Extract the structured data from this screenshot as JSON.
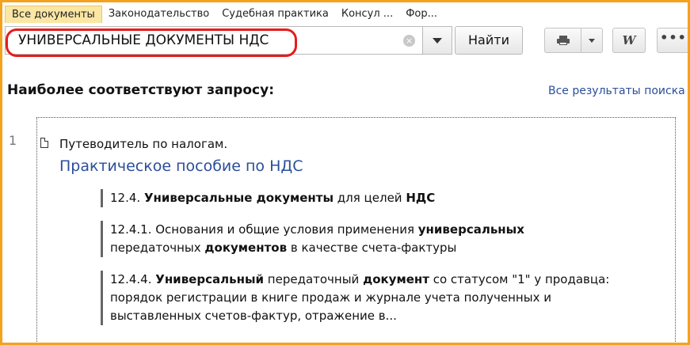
{
  "tabs": [
    {
      "label": "Все документы",
      "active": true
    },
    {
      "label": "Законодательство"
    },
    {
      "label": "Судебная практика"
    },
    {
      "label": "Консул ..."
    },
    {
      "label": "Фор..."
    }
  ],
  "search": {
    "value": "УНИВЕРСАЛЬНЫЕ ДОКУМЕНТЫ НДС",
    "clear_glyph": "×",
    "find_label": "Найти"
  },
  "toolbar": {
    "word_label": "W",
    "more_label": "•••"
  },
  "results": {
    "heading": "Наиболее соответствуют запросу:",
    "all_results_label": "Все результаты поиска",
    "items": [
      {
        "number": "1",
        "source": "Путеводитель по налогам.",
        "title": "Практическое пособие по НДС",
        "sections": [
          {
            "parts": [
              {
                "t": "12.4. ",
                "b": false
              },
              {
                "t": "Универсальные документы",
                "b": true
              },
              {
                "t": " для целей ",
                "b": false
              },
              {
                "t": "НДС",
                "b": true
              }
            ]
          },
          {
            "parts": [
              {
                "t": "12.4.1. Основания и общие условия применения ",
                "b": false
              },
              {
                "t": "универсальных",
                "b": true
              },
              {
                "t": " передаточных ",
                "b": false
              },
              {
                "t": "документов",
                "b": true
              },
              {
                "t": " в качестве счета-фактуры",
                "b": false
              }
            ]
          },
          {
            "parts": [
              {
                "t": "12.4.4. ",
                "b": false
              },
              {
                "t": "Универсальный",
                "b": true
              },
              {
                "t": " передаточный ",
                "b": false
              },
              {
                "t": "документ",
                "b": true
              },
              {
                "t": " со статусом \"1\" у продавца: порядок регистрации в книге продаж и журнале учета полученных и выставленных счетов-фактур, отражение в...",
                "b": false
              }
            ]
          }
        ]
      }
    ]
  },
  "colors": {
    "accent": "#f4a21c",
    "highlight": "#e61b1b",
    "link": "#2a4e9b",
    "active_tab": "#fbe6a4"
  }
}
